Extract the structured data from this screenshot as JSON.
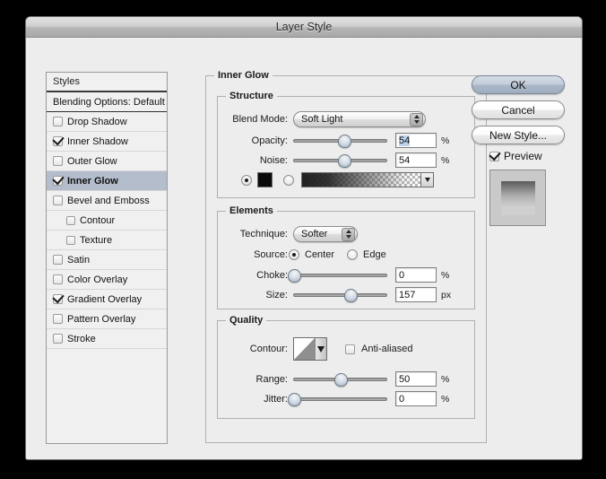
{
  "window": {
    "title": "Layer Style"
  },
  "sidebar": {
    "header": "Styles",
    "blending_options": "Blending Options: Default",
    "items": [
      {
        "label": "Drop Shadow",
        "checked": false,
        "selected": false,
        "indent": false
      },
      {
        "label": "Inner Shadow",
        "checked": true,
        "selected": false,
        "indent": false
      },
      {
        "label": "Outer Glow",
        "checked": false,
        "selected": false,
        "indent": false
      },
      {
        "label": "Inner Glow",
        "checked": true,
        "selected": true,
        "indent": false
      },
      {
        "label": "Bevel and Emboss",
        "checked": false,
        "selected": false,
        "indent": false
      },
      {
        "label": "Contour",
        "checked": false,
        "selected": false,
        "indent": true
      },
      {
        "label": "Texture",
        "checked": false,
        "selected": false,
        "indent": true
      },
      {
        "label": "Satin",
        "checked": false,
        "selected": false,
        "indent": false
      },
      {
        "label": "Color Overlay",
        "checked": false,
        "selected": false,
        "indent": false
      },
      {
        "label": "Gradient Overlay",
        "checked": true,
        "selected": false,
        "indent": false
      },
      {
        "label": "Pattern Overlay",
        "checked": false,
        "selected": false,
        "indent": false
      },
      {
        "label": "Stroke",
        "checked": false,
        "selected": false,
        "indent": false
      }
    ]
  },
  "main": {
    "panel_title": "Inner Glow",
    "structure": {
      "legend": "Structure",
      "blend_mode_label": "Blend Mode:",
      "blend_mode_value": "Soft Light",
      "opacity_label": "Opacity:",
      "opacity_value": "54",
      "opacity_unit": "%",
      "opacity_pct": 54,
      "noise_label": "Noise:",
      "noise_value": "54",
      "noise_unit": "%",
      "noise_pct": 54,
      "fill_color_hex": "#0a0a0a",
      "fill_type": "color"
    },
    "elements": {
      "legend": "Elements",
      "technique_label": "Technique:",
      "technique_value": "Softer",
      "source_label": "Source:",
      "source_center": "Center",
      "source_edge": "Edge",
      "source_value": "Center",
      "choke_label": "Choke:",
      "choke_value": "0",
      "choke_unit": "%",
      "choke_pct": 0,
      "size_label": "Size:",
      "size_value": "157",
      "size_unit": "px",
      "size_pct": 60
    },
    "quality": {
      "legend": "Quality",
      "contour_label": "Contour:",
      "antialiased_label": "Anti-aliased",
      "antialiased_checked": false,
      "range_label": "Range:",
      "range_value": "50",
      "range_unit": "%",
      "range_pct": 50,
      "jitter_label": "Jitter:",
      "jitter_value": "0",
      "jitter_unit": "%",
      "jitter_pct": 0
    }
  },
  "actions": {
    "ok": "OK",
    "cancel": "Cancel",
    "new_style": "New Style...",
    "preview_label": "Preview",
    "preview_checked": true
  },
  "colors": {
    "window_bg": "#ededed",
    "selection": "#b4bdcb",
    "field_selection": "#bcd3ea",
    "default_button": "#aab7c8"
  }
}
